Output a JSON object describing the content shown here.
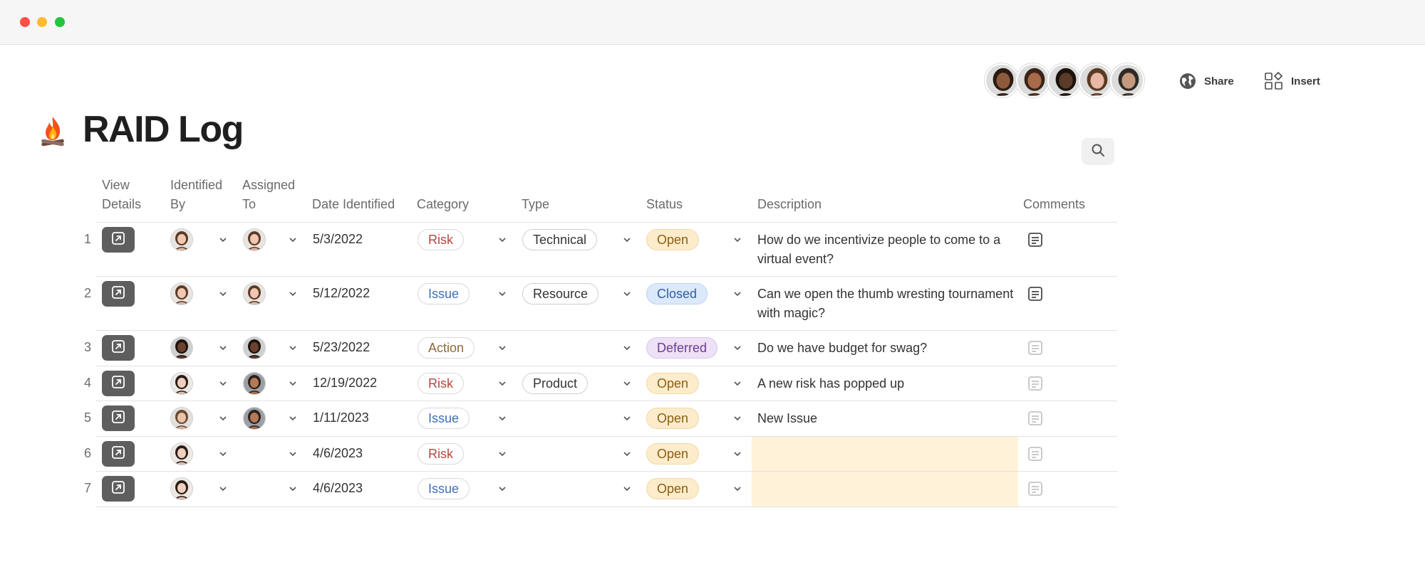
{
  "window": {
    "controls": [
      "close",
      "minimize",
      "maximize"
    ]
  },
  "toolbar": {
    "share_label": "Share",
    "insert_label": "Insert",
    "collaborators": [
      {
        "skin": "#8d5a3b",
        "hair": "#2a1a12"
      },
      {
        "skin": "#a86a48",
        "hair": "#3a2418"
      },
      {
        "skin": "#5a3a28",
        "hair": "#1a120c"
      },
      {
        "skin": "#e9b8a4",
        "hair": "#5a3a22"
      },
      {
        "skin": "#c69a7e",
        "hair": "#2e2a26"
      }
    ]
  },
  "doc": {
    "icon": "campfire-icon",
    "title": "RAID Log"
  },
  "table": {
    "columns": [
      {
        "key": "view",
        "label_lines": [
          "View",
          "Details"
        ]
      },
      {
        "key": "identified_by",
        "label_lines": [
          "Identified",
          "By"
        ]
      },
      {
        "key": "assigned_to",
        "label_lines": [
          "Assigned",
          "To"
        ]
      },
      {
        "key": "date",
        "label_lines": [
          "Date Identified"
        ]
      },
      {
        "key": "category",
        "label_lines": [
          "Category"
        ]
      },
      {
        "key": "type",
        "label_lines": [
          "Type"
        ]
      },
      {
        "key": "status",
        "label_lines": [
          "Status"
        ]
      },
      {
        "key": "description",
        "label_lines": [
          "Description"
        ]
      },
      {
        "key": "comments",
        "label_lines": [
          "Comments"
        ]
      }
    ],
    "rows": [
      {
        "num": "1",
        "identified_by": "woman-1",
        "assigned_to": "woman-1",
        "date": "5/3/2022",
        "category": "Risk",
        "type": "Technical",
        "status": "Open",
        "description": "How do we incentivize people to come to a virtual event?",
        "has_comments": true
      },
      {
        "num": "2",
        "identified_by": "woman-1",
        "assigned_to": "woman-1",
        "date": "5/12/2022",
        "category": "Issue",
        "type": "Resource",
        "status": "Closed",
        "description": "Can we open the thumb wresting tournament with magic?",
        "has_comments": true
      },
      {
        "num": "3",
        "identified_by": "man-1",
        "assigned_to": "man-1",
        "date": "5/23/2022",
        "category": "Action",
        "type": "",
        "status": "Deferred",
        "description": "Do we have budget for swag?",
        "has_comments": false
      },
      {
        "num": "4",
        "identified_by": "woman-2",
        "assigned_to": "man-2",
        "date": "12/19/2022",
        "category": "Risk",
        "type": "Product",
        "status": "Open",
        "description": "A new risk has popped up",
        "has_comments": false
      },
      {
        "num": "5",
        "identified_by": "woman-3",
        "assigned_to": "man-2",
        "date": "1/11/2023",
        "category": "Issue",
        "type": "",
        "status": "Open",
        "description": "New Issue",
        "has_comments": false
      },
      {
        "num": "6",
        "identified_by": "woman-2",
        "assigned_to": "",
        "date": "4/6/2023",
        "category": "Risk",
        "type": "",
        "status": "Open",
        "description": "",
        "has_comments": false
      },
      {
        "num": "7",
        "identified_by": "woman-2",
        "assigned_to": "",
        "date": "4/6/2023",
        "category": "Issue",
        "type": "",
        "status": "Open",
        "description": "",
        "has_comments": false
      }
    ]
  },
  "colors": {
    "category": {
      "Risk": "#b5473f",
      "Issue": "#3f6fb5",
      "Action": "#8a6a3a"
    },
    "status": {
      "Open": {
        "bg": "#fdeccb",
        "border": "#f3d9a4",
        "fg": "#8a5d12"
      },
      "Closed": {
        "bg": "#dbe9fb",
        "border": "#b9d2f3",
        "fg": "#2f5f9e"
      },
      "Deferred": {
        "bg": "#eee0f6",
        "border": "#dcc6ec",
        "fg": "#6b3f8c"
      }
    },
    "empty_description_highlight": "#fff2d9"
  }
}
